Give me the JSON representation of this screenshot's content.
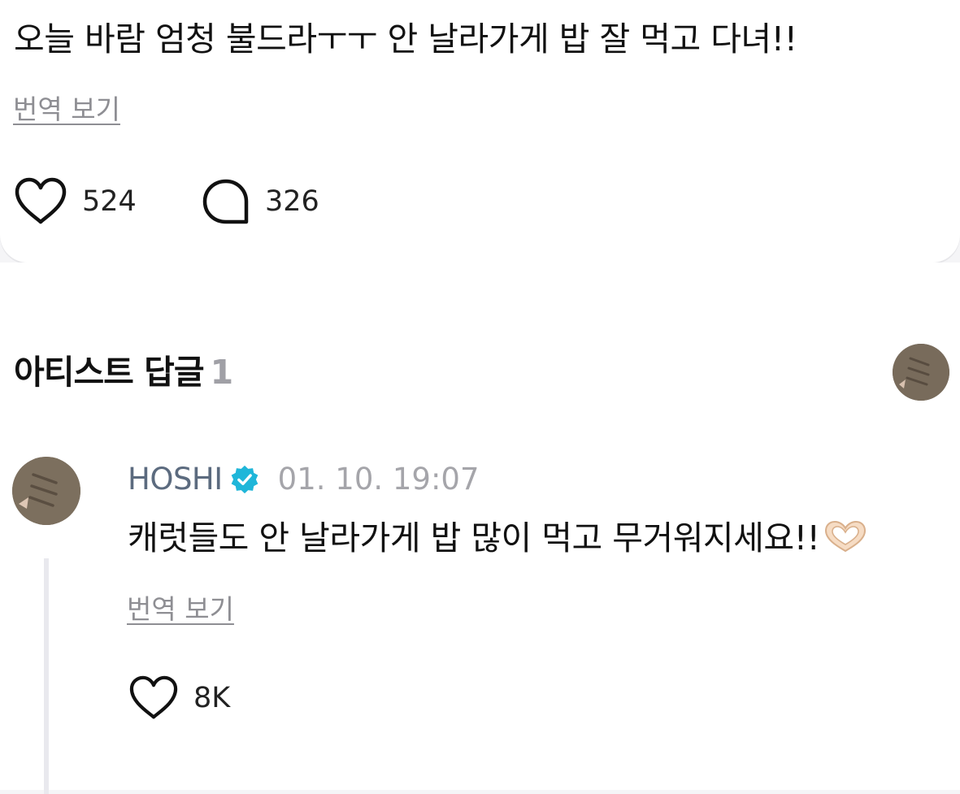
{
  "post": {
    "text": "오늘 바람 엄청 불드라ㅜㅜ 안 날라가게 밥 잘 먹고 다녀!!",
    "translate_label": "번역 보기",
    "likes": "524",
    "comments": "326",
    "like_icon": "heart-outline-icon",
    "comment_icon": "speech-bubble-icon"
  },
  "artist_replies": {
    "title": "아티스트 답글",
    "count": "1",
    "reply": {
      "author": "HOSHI",
      "verified_icon": "verified-badge-icon",
      "timestamp": "01. 10. 19:07",
      "text": "캐럿들도 안 날라가게 밥 많이 먹고 무거워지세요!!",
      "emoji": "heart-hands-emoji",
      "translate_label": "번역 보기",
      "likes": "8K"
    }
  },
  "colors": {
    "author": "#5c6b7f",
    "verified": "#1fb6d9",
    "muted": "#8e8e93",
    "count_gray": "#a0a0a6",
    "background": "#f5f5f7"
  }
}
